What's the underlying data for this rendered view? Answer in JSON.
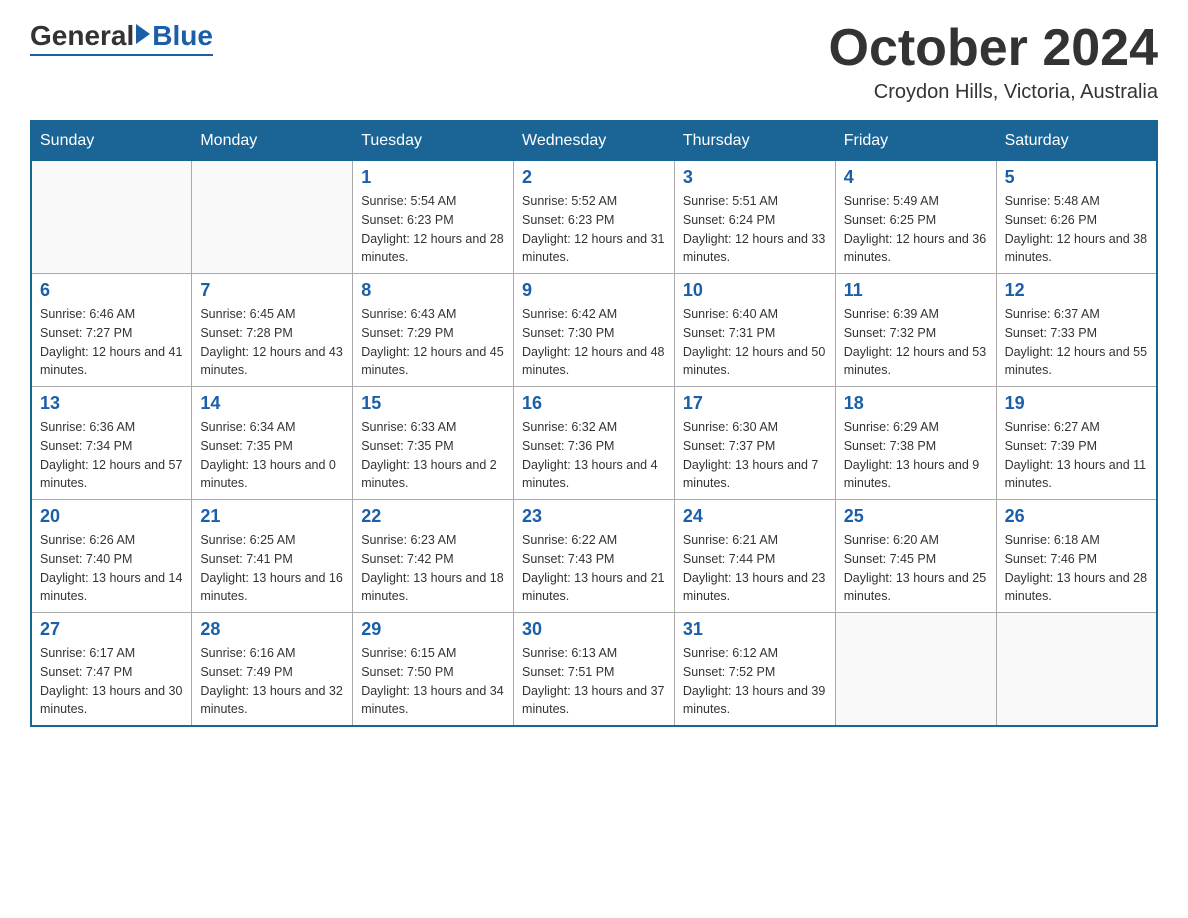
{
  "header": {
    "logo_general": "General",
    "logo_blue": "Blue",
    "month_title": "October 2024",
    "location": "Croydon Hills, Victoria, Australia"
  },
  "days_of_week": [
    "Sunday",
    "Monday",
    "Tuesday",
    "Wednesday",
    "Thursday",
    "Friday",
    "Saturday"
  ],
  "weeks": [
    [
      {
        "day": "",
        "sunrise": "",
        "sunset": "",
        "daylight": ""
      },
      {
        "day": "",
        "sunrise": "",
        "sunset": "",
        "daylight": ""
      },
      {
        "day": "1",
        "sunrise": "Sunrise: 5:54 AM",
        "sunset": "Sunset: 6:23 PM",
        "daylight": "Daylight: 12 hours and 28 minutes."
      },
      {
        "day": "2",
        "sunrise": "Sunrise: 5:52 AM",
        "sunset": "Sunset: 6:23 PM",
        "daylight": "Daylight: 12 hours and 31 minutes."
      },
      {
        "day": "3",
        "sunrise": "Sunrise: 5:51 AM",
        "sunset": "Sunset: 6:24 PM",
        "daylight": "Daylight: 12 hours and 33 minutes."
      },
      {
        "day": "4",
        "sunrise": "Sunrise: 5:49 AM",
        "sunset": "Sunset: 6:25 PM",
        "daylight": "Daylight: 12 hours and 36 minutes."
      },
      {
        "day": "5",
        "sunrise": "Sunrise: 5:48 AM",
        "sunset": "Sunset: 6:26 PM",
        "daylight": "Daylight: 12 hours and 38 minutes."
      }
    ],
    [
      {
        "day": "6",
        "sunrise": "Sunrise: 6:46 AM",
        "sunset": "Sunset: 7:27 PM",
        "daylight": "Daylight: 12 hours and 41 minutes."
      },
      {
        "day": "7",
        "sunrise": "Sunrise: 6:45 AM",
        "sunset": "Sunset: 7:28 PM",
        "daylight": "Daylight: 12 hours and 43 minutes."
      },
      {
        "day": "8",
        "sunrise": "Sunrise: 6:43 AM",
        "sunset": "Sunset: 7:29 PM",
        "daylight": "Daylight: 12 hours and 45 minutes."
      },
      {
        "day": "9",
        "sunrise": "Sunrise: 6:42 AM",
        "sunset": "Sunset: 7:30 PM",
        "daylight": "Daylight: 12 hours and 48 minutes."
      },
      {
        "day": "10",
        "sunrise": "Sunrise: 6:40 AM",
        "sunset": "Sunset: 7:31 PM",
        "daylight": "Daylight: 12 hours and 50 minutes."
      },
      {
        "day": "11",
        "sunrise": "Sunrise: 6:39 AM",
        "sunset": "Sunset: 7:32 PM",
        "daylight": "Daylight: 12 hours and 53 minutes."
      },
      {
        "day": "12",
        "sunrise": "Sunrise: 6:37 AM",
        "sunset": "Sunset: 7:33 PM",
        "daylight": "Daylight: 12 hours and 55 minutes."
      }
    ],
    [
      {
        "day": "13",
        "sunrise": "Sunrise: 6:36 AM",
        "sunset": "Sunset: 7:34 PM",
        "daylight": "Daylight: 12 hours and 57 minutes."
      },
      {
        "day": "14",
        "sunrise": "Sunrise: 6:34 AM",
        "sunset": "Sunset: 7:35 PM",
        "daylight": "Daylight: 13 hours and 0 minutes."
      },
      {
        "day": "15",
        "sunrise": "Sunrise: 6:33 AM",
        "sunset": "Sunset: 7:35 PM",
        "daylight": "Daylight: 13 hours and 2 minutes."
      },
      {
        "day": "16",
        "sunrise": "Sunrise: 6:32 AM",
        "sunset": "Sunset: 7:36 PM",
        "daylight": "Daylight: 13 hours and 4 minutes."
      },
      {
        "day": "17",
        "sunrise": "Sunrise: 6:30 AM",
        "sunset": "Sunset: 7:37 PM",
        "daylight": "Daylight: 13 hours and 7 minutes."
      },
      {
        "day": "18",
        "sunrise": "Sunrise: 6:29 AM",
        "sunset": "Sunset: 7:38 PM",
        "daylight": "Daylight: 13 hours and 9 minutes."
      },
      {
        "day": "19",
        "sunrise": "Sunrise: 6:27 AM",
        "sunset": "Sunset: 7:39 PM",
        "daylight": "Daylight: 13 hours and 11 minutes."
      }
    ],
    [
      {
        "day": "20",
        "sunrise": "Sunrise: 6:26 AM",
        "sunset": "Sunset: 7:40 PM",
        "daylight": "Daylight: 13 hours and 14 minutes."
      },
      {
        "day": "21",
        "sunrise": "Sunrise: 6:25 AM",
        "sunset": "Sunset: 7:41 PM",
        "daylight": "Daylight: 13 hours and 16 minutes."
      },
      {
        "day": "22",
        "sunrise": "Sunrise: 6:23 AM",
        "sunset": "Sunset: 7:42 PM",
        "daylight": "Daylight: 13 hours and 18 minutes."
      },
      {
        "day": "23",
        "sunrise": "Sunrise: 6:22 AM",
        "sunset": "Sunset: 7:43 PM",
        "daylight": "Daylight: 13 hours and 21 minutes."
      },
      {
        "day": "24",
        "sunrise": "Sunrise: 6:21 AM",
        "sunset": "Sunset: 7:44 PM",
        "daylight": "Daylight: 13 hours and 23 minutes."
      },
      {
        "day": "25",
        "sunrise": "Sunrise: 6:20 AM",
        "sunset": "Sunset: 7:45 PM",
        "daylight": "Daylight: 13 hours and 25 minutes."
      },
      {
        "day": "26",
        "sunrise": "Sunrise: 6:18 AM",
        "sunset": "Sunset: 7:46 PM",
        "daylight": "Daylight: 13 hours and 28 minutes."
      }
    ],
    [
      {
        "day": "27",
        "sunrise": "Sunrise: 6:17 AM",
        "sunset": "Sunset: 7:47 PM",
        "daylight": "Daylight: 13 hours and 30 minutes."
      },
      {
        "day": "28",
        "sunrise": "Sunrise: 6:16 AM",
        "sunset": "Sunset: 7:49 PM",
        "daylight": "Daylight: 13 hours and 32 minutes."
      },
      {
        "day": "29",
        "sunrise": "Sunrise: 6:15 AM",
        "sunset": "Sunset: 7:50 PM",
        "daylight": "Daylight: 13 hours and 34 minutes."
      },
      {
        "day": "30",
        "sunrise": "Sunrise: 6:13 AM",
        "sunset": "Sunset: 7:51 PM",
        "daylight": "Daylight: 13 hours and 37 minutes."
      },
      {
        "day": "31",
        "sunrise": "Sunrise: 6:12 AM",
        "sunset": "Sunset: 7:52 PM",
        "daylight": "Daylight: 13 hours and 39 minutes."
      },
      {
        "day": "",
        "sunrise": "",
        "sunset": "",
        "daylight": ""
      },
      {
        "day": "",
        "sunrise": "",
        "sunset": "",
        "daylight": ""
      }
    ]
  ]
}
